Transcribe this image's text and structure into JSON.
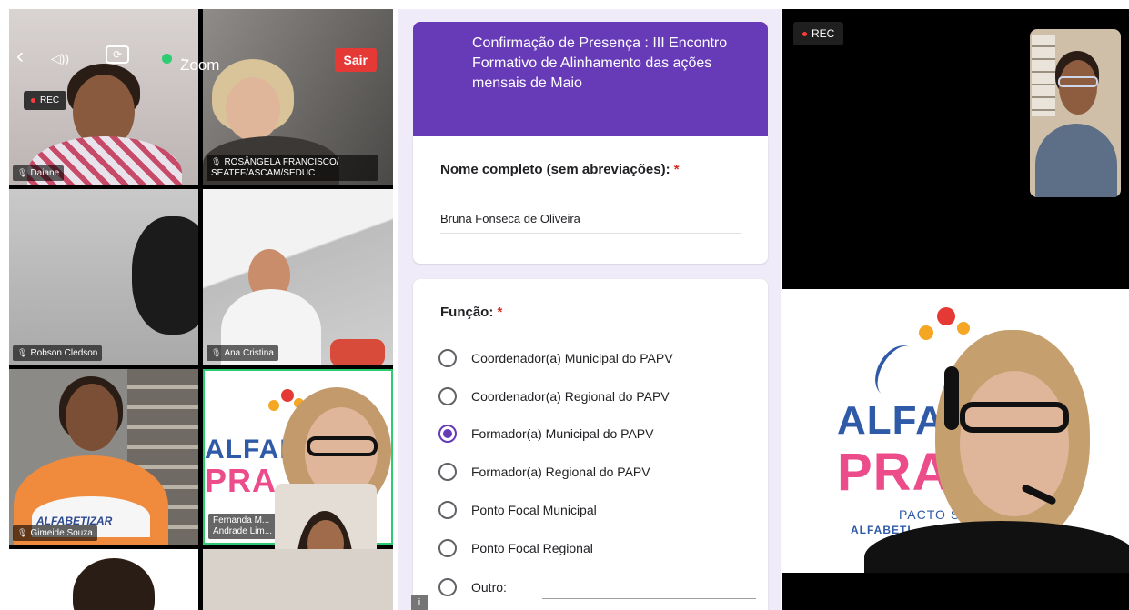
{
  "zoom_toolbar": {
    "app_name": "Zoom",
    "leave_label": "Sair",
    "rec_label": "REC"
  },
  "participants": [
    {
      "name": "Daiane"
    },
    {
      "name": "ROSÂNGELA FRANCISCO/ SEATEF/ASCAM/SEDUC"
    },
    {
      "name": "Robson Cledson"
    },
    {
      "name": "Ana Cristina"
    },
    {
      "name": "Gimeide Souza"
    },
    {
      "name": "Fernanda M... Andrade Lim..."
    }
  ],
  "tile_shirt_text": "ALFABETIZAR",
  "logo": {
    "word1": "ALFAB",
    "word2": "PRA",
    "sub1": "PACTO S",
    "sub2": "ALFABETI"
  },
  "form": {
    "title": "Confirmação de Presença : III Encontro Formativo de Alinhamento das ações mensais de Maio",
    "q1_label": "Nome completo (sem abreviações):",
    "required_mark": "*",
    "q1_answer": "Bruna Fonseca de Oliveira",
    "q2_label": "Função:",
    "options": [
      "Coordenador(a) Municipal do PAPV",
      "Coordenador(a) Regional do PAPV",
      "Formador(a) Municipal do PAPV",
      "Formador(a) Regional do PAPV",
      "Ponto Focal Municipal",
      "Ponto Focal Regional",
      "Outro:"
    ],
    "selected_option": "Formador(a) Municipal do PAPV"
  },
  "right_panel": {
    "rec_label": "REC",
    "logo_word1": "ALFAB",
    "logo_word2": "PRA",
    "logo_sub1": "PACTO S",
    "logo_sub2": "ALFABETI"
  },
  "colors": {
    "form_accent": "#673ab7",
    "form_bg": "#f0ebf8",
    "leave_button": "#e53935",
    "required": "#d93025"
  },
  "icons": [
    "back-icon",
    "speaker-icon",
    "camera-switch-icon",
    "zoom-shield-icon",
    "chevron-down-icon",
    "mic-icon",
    "radio-icon"
  ]
}
